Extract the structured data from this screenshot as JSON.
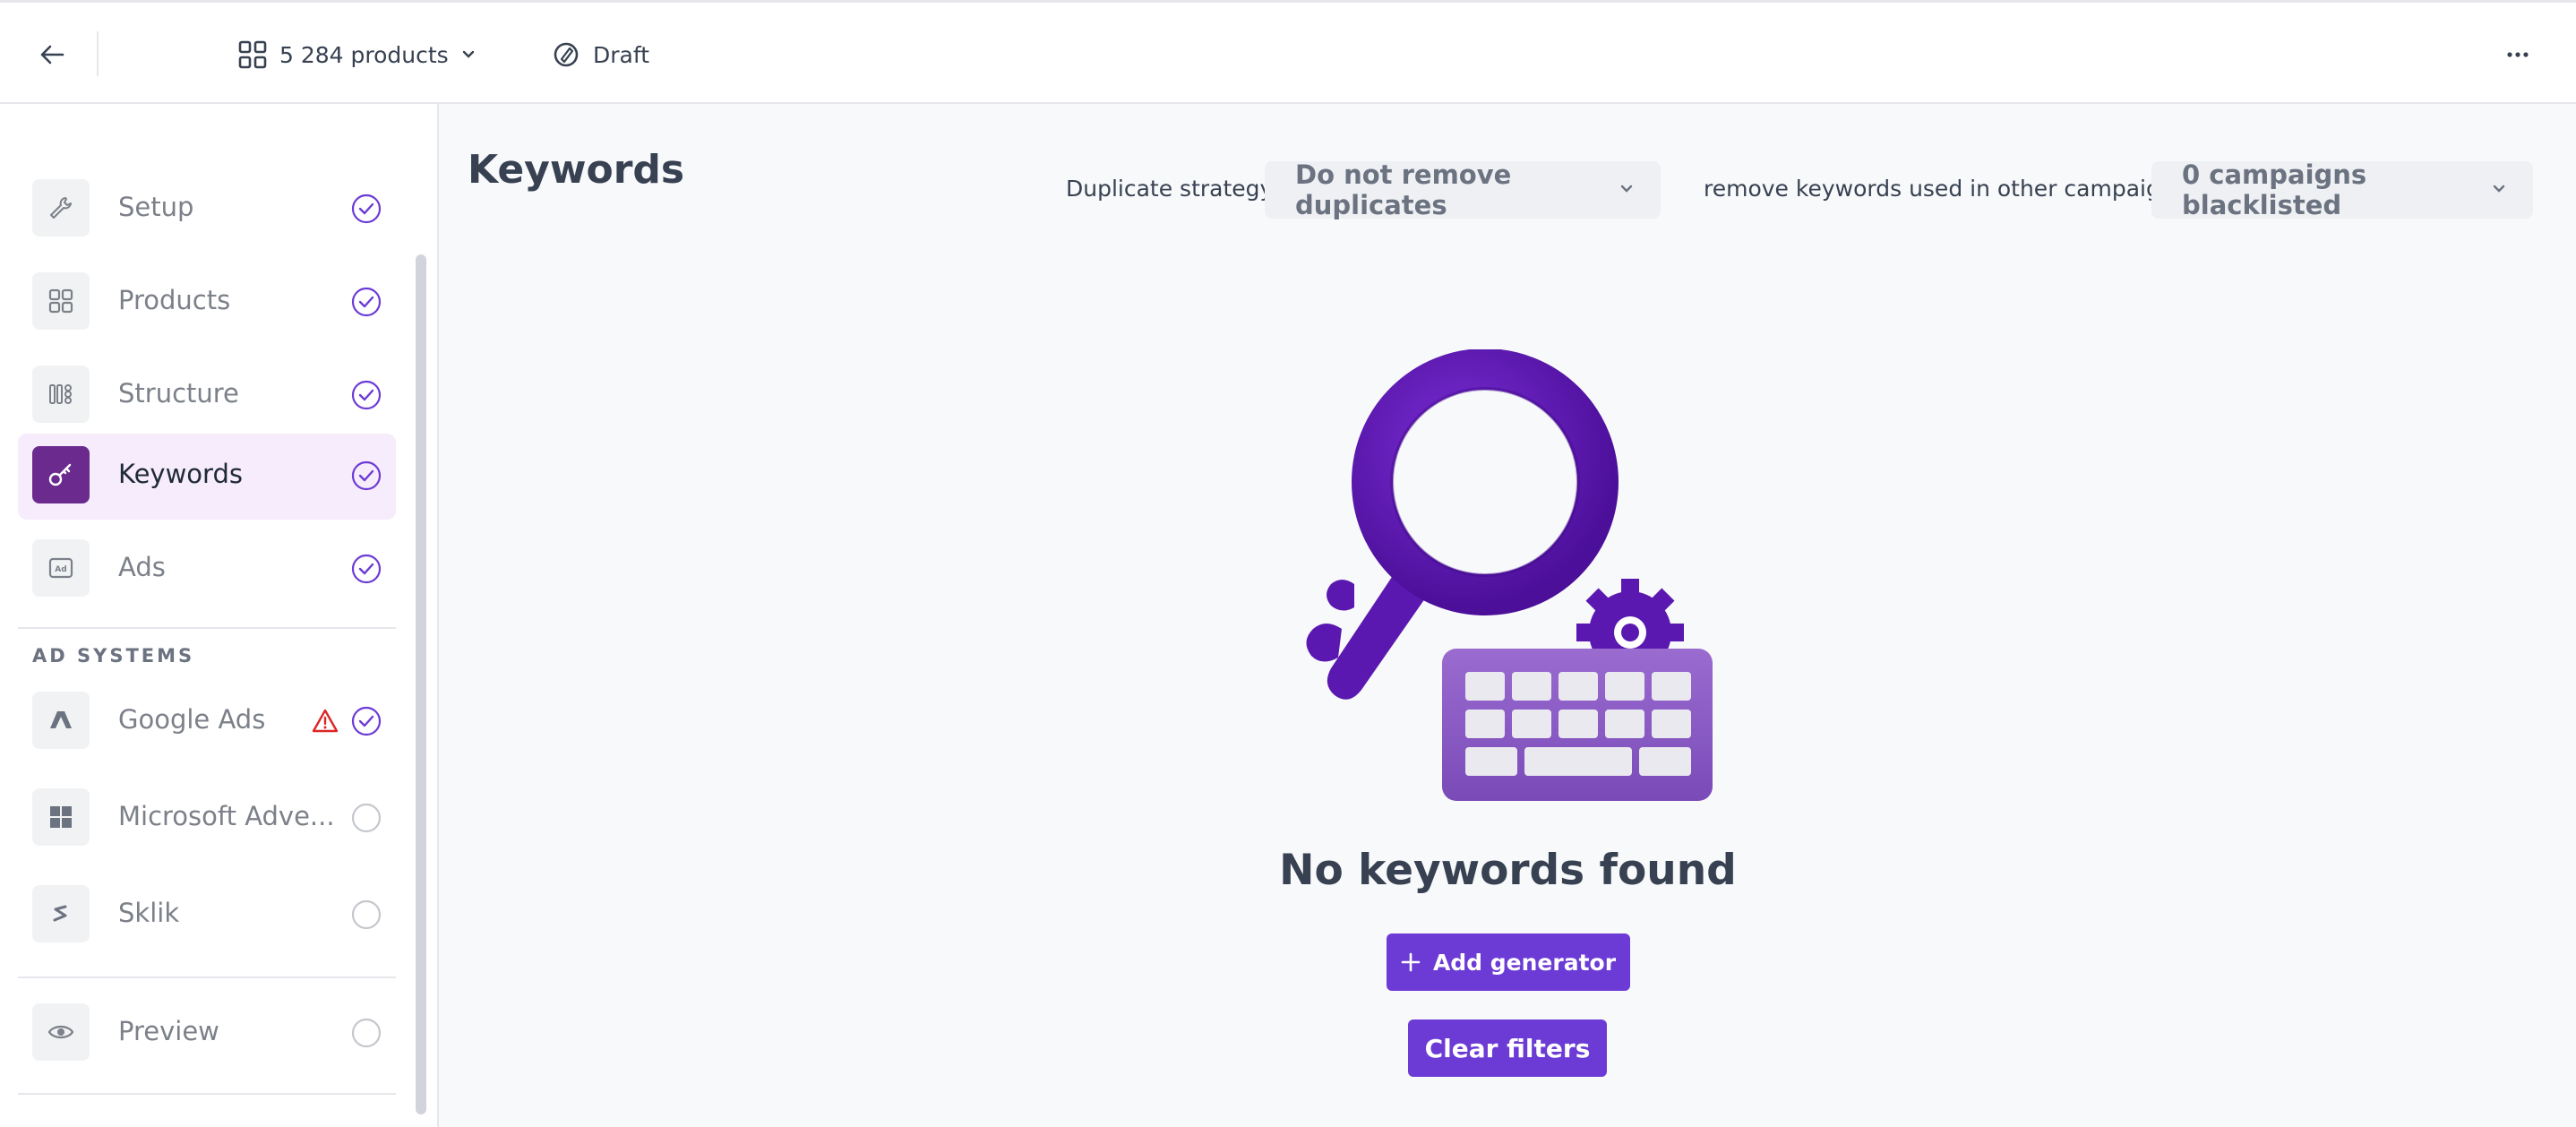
{
  "topbar": {
    "products_label": "5 284 products",
    "status_label": "Draft"
  },
  "sidebar": {
    "items": [
      {
        "label": "Setup",
        "icon": "wrench-icon",
        "status": "complete"
      },
      {
        "label": "Products",
        "icon": "grid-icon",
        "status": "complete"
      },
      {
        "label": "Structure",
        "icon": "structure-icon",
        "status": "complete"
      },
      {
        "label": "Keywords",
        "icon": "key-icon",
        "status": "complete",
        "active": true
      },
      {
        "label": "Ads",
        "icon": "ad-icon",
        "status": "complete"
      }
    ],
    "ad_systems_heading": "AD SYSTEMS",
    "ad_systems": [
      {
        "label": "Google Ads",
        "icon": "google-ads-icon",
        "status": "complete",
        "warning": true
      },
      {
        "label": "Microsoft Adve...",
        "icon": "microsoft-icon",
        "status": "incomplete"
      },
      {
        "label": "Sklik",
        "icon": "sklik-icon",
        "status": "incomplete"
      }
    ],
    "preview": {
      "label": "Preview",
      "icon": "eye-icon",
      "status": "incomplete"
    }
  },
  "main": {
    "title": "Keywords",
    "duplicate_strategy_label": "Duplicate strategy",
    "duplicate_strategy_value": "Do not remove duplicates",
    "remove_keywords_label": "remove keywords used in other campaigns",
    "campaigns_value": "0 campaigns blacklisted",
    "empty_title": "No keywords found",
    "add_generator_label": "Add generator",
    "clear_filters_label": "Clear filters"
  },
  "colors": {
    "accent": "#6c3bd6",
    "active_bg": "#f6ecfb",
    "active_icon": "#6b2a8e",
    "check": "#6c3bd6",
    "warning": "#dc2626"
  }
}
